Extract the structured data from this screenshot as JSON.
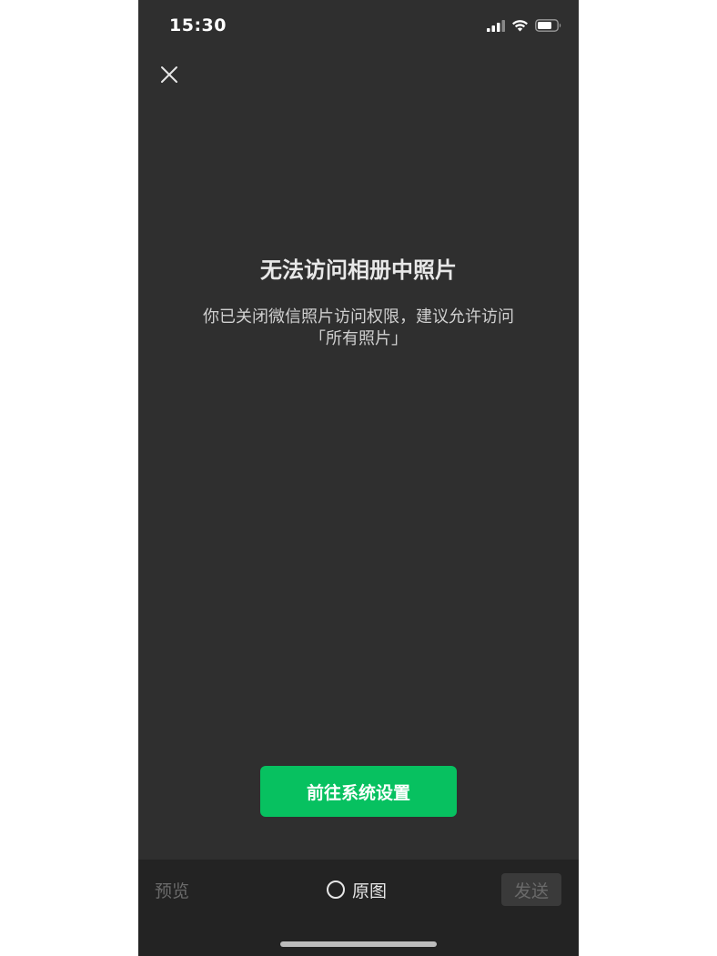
{
  "status_bar": {
    "time": "15:30",
    "icons": [
      "cellular-signal-icon",
      "wifi-icon",
      "battery-icon"
    ]
  },
  "toolbar": {
    "close_icon": "close-icon"
  },
  "content": {
    "title": "无法访问相册中照片",
    "message_line1": "你已关闭微信照片访问权限，建议允许访问",
    "message_line2": "「所有照片」",
    "settings_button_label": "前往系统设置"
  },
  "bottom_bar": {
    "preview_label": "预览",
    "original_label": "原图",
    "send_label": "发送"
  },
  "colors": {
    "background": "#2f2f2f",
    "accent_green": "#07c160",
    "bottom_bar": "#232323"
  }
}
